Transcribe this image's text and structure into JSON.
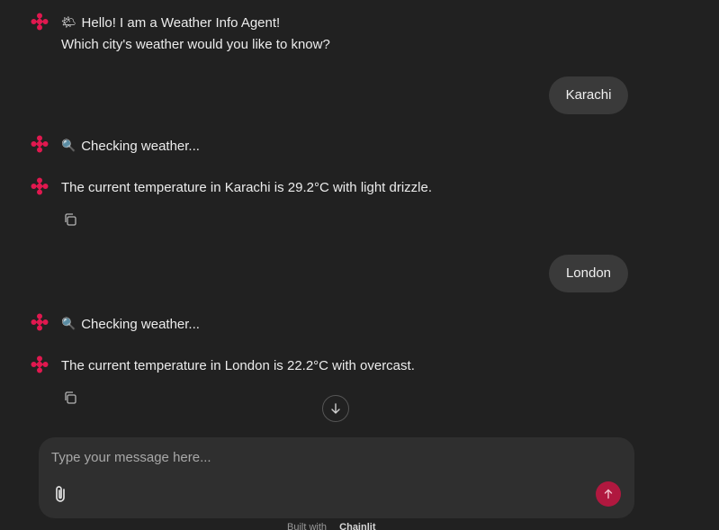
{
  "messages": [
    {
      "role": "assistant",
      "icon": "sun-behind-cloud",
      "emoji": "🌤",
      "text": "Hello! I am a Weather Info Agent!",
      "line2": "Which city's weather would you like to know?"
    },
    {
      "role": "user",
      "text": "Karachi"
    },
    {
      "role": "assistant",
      "icon": "magnifying-glass",
      "emoji": "🔍",
      "text": "Checking weather..."
    },
    {
      "role": "assistant",
      "text": "The current temperature in Karachi is 29.2°C with light drizzle."
    },
    {
      "role": "user",
      "text": "London"
    },
    {
      "role": "assistant",
      "icon": "magnifying-glass",
      "emoji": "🔍",
      "text": "Checking weather..."
    },
    {
      "role": "assistant",
      "text": "The current temperature in London is 22.2°C with overcast."
    }
  ],
  "composer": {
    "placeholder": "Type your message here..."
  },
  "footer": {
    "prefix": "Built with",
    "brand": "Chainlit"
  },
  "colors": {
    "background": "#212121",
    "bubble": "#3a3a3a",
    "accent": "#e0184f",
    "send": "#b0183f"
  }
}
